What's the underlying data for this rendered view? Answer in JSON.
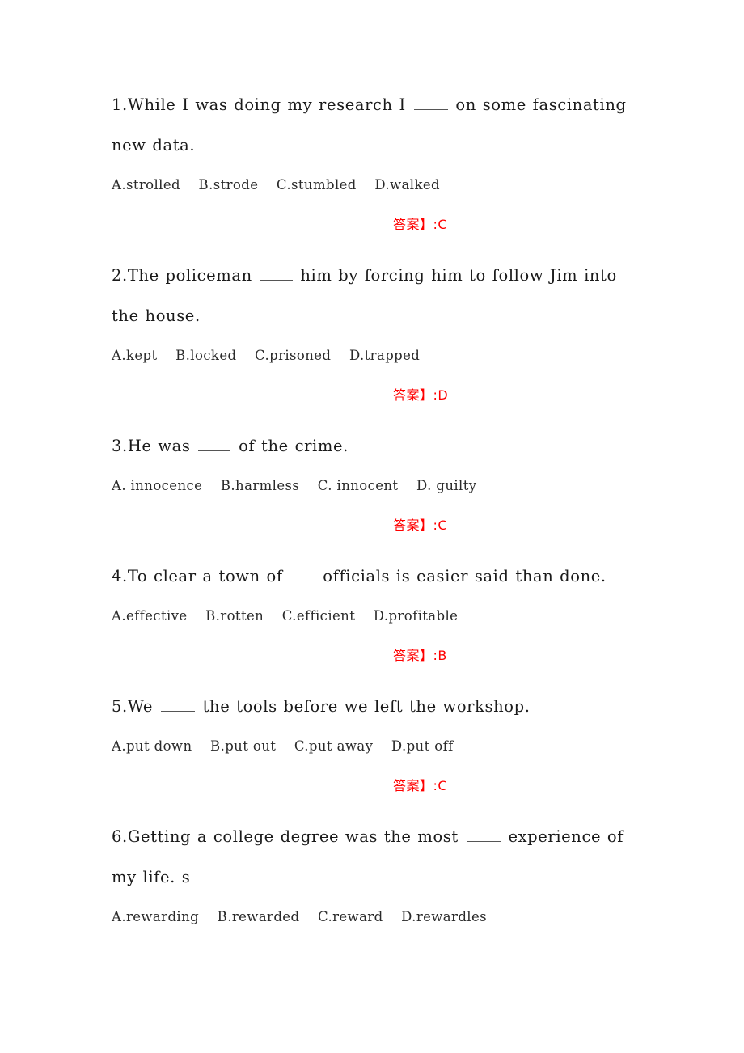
{
  "document": {
    "type": "english-multiple-choice-worksheet",
    "page_background": "#ffffff",
    "answer_color": "#ff0000",
    "text_color": "#1a1a1a",
    "answer_prefix": "答案】:"
  },
  "questions": [
    {
      "number": "1.",
      "stem_before": "While I was doing my research I ",
      "blank_width": 42,
      "stem_after": " on some fascinating new data.",
      "stem_full": "1.While I was doing my research I ____ on some fascinating new data.",
      "options": "A.strolled    B.strode    C.stumbled    D.walked",
      "option_list": [
        "A.strolled",
        "B.strode",
        "C.stumbled",
        "D.walked"
      ],
      "answer_label": "答案】:C",
      "answer_letter": "C"
    },
    {
      "number": "2.",
      "stem_before": "The policeman ",
      "blank_width": 40,
      "stem_after": " him by forcing him to follow Jim into the house.",
      "stem_full": "2.The policeman ____ him by forcing him to follow Jim into the house.",
      "options": "A.kept    B.locked    C.prisoned    D.trapped",
      "option_list": [
        "A.kept",
        "B.locked",
        "C.prisoned",
        "D.trapped"
      ],
      "answer_label": "答案】:D",
      "answer_letter": "D"
    },
    {
      "number": "3.",
      "stem_before": "He was ",
      "blank_width": 40,
      "stem_after": " of the crime.",
      "stem_full": "3.He was ____ of the crime.",
      "options": "A. innocence    B.harmless    C. innocent    D. guilty",
      "option_list": [
        "A. innocence",
        "B.harmless",
        "C. innocent",
        "D. guilty"
      ],
      "answer_label": "答案】:C",
      "answer_letter": "C"
    },
    {
      "number": "4.",
      "stem_before": "To clear a town of ",
      "blank_width": 30,
      "stem_after": " officials is easier said than done.",
      "stem_full": "4.To clear a town of ___ officials is easier said than done.",
      "options": "A.effective    B.rotten    C.efficient    D.profitable",
      "option_list": [
        "A.effective",
        "B.rotten",
        "C.efficient",
        "D.profitable"
      ],
      "answer_label": "答案】:B",
      "answer_letter": "B"
    },
    {
      "number": "5.",
      "stem_before": "We ",
      "blank_width": 42,
      "stem_after": " the tools before we left the workshop.",
      "stem_full": "5.We ____ the tools before we left the workshop.",
      "options": "A.put down    B.put out    C.put away    D.put off",
      "option_list": [
        "A.put down",
        "B.put out",
        "C.put away",
        "D.put off"
      ],
      "answer_label": "答案】:C",
      "answer_letter": "C"
    },
    {
      "number": "6.",
      "stem_before": "Getting a college degree was the most ",
      "blank_width": 42,
      "stem_after": " experience of my life. s",
      "stem_full": "6.Getting a college degree was the most ____ experience of my life. s",
      "options": "A.rewarding    B.rewarded    C.reward    D.rewardles",
      "option_list": [
        "A.rewarding",
        "B.rewarded",
        "C.reward",
        "D.rewardles"
      ],
      "answer_label": "",
      "answer_letter": ""
    }
  ]
}
